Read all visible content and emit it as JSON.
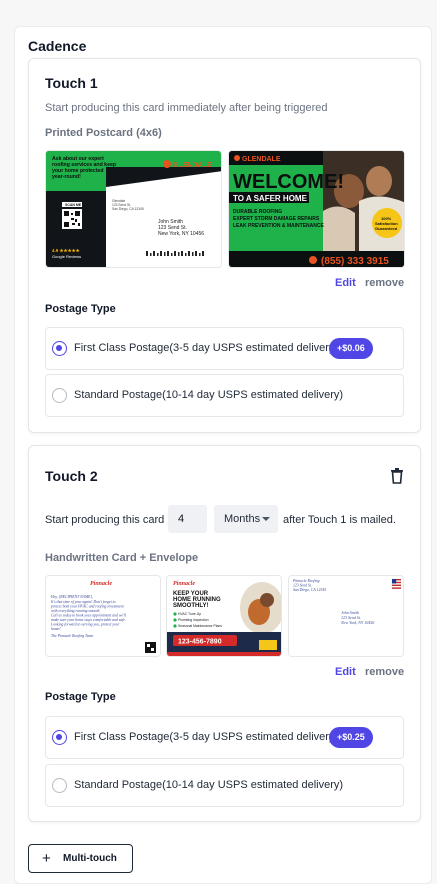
{
  "cadence": {
    "title": "Cadence"
  },
  "touch1": {
    "title": "Touch 1",
    "subtitle": "Start producing this card immediately after being triggered",
    "card_type": "Printed Postcard (4x6)",
    "front": {
      "headline": "Ask about our expert roofing services and keep your home protected year-round!",
      "scan_label": "SCAN ME",
      "rating": "4.9 ★★★★★",
      "reviews": "Google Reviews",
      "brand": "GLENDALE",
      "return_address": [
        "Glendale",
        "123 Send St.",
        "San Diego, CA 12345"
      ],
      "recipient": [
        "John Smith",
        "123 Send St.",
        "New York, NY 10456"
      ]
    },
    "back": {
      "brand": "GLENDALE",
      "welcome": "WELCOME!",
      "tagline": "TO A SAFER HOME",
      "bullets": [
        "DURABLE ROOFING",
        "EXPERT STORM DAMAGE REPAIRS",
        "LEAK PREVENTION & MAINTENANCE"
      ],
      "guarantee": "100% Satisfaction Guaranteed",
      "phone": "(855) 333 3915"
    },
    "edit_label": "Edit",
    "remove_label": "remove",
    "postage_title": "Postage Type",
    "options": [
      {
        "name": "First Class Postage",
        "desc": "(3-5 day USPS estimated delivery)",
        "price": "+$0.06",
        "selected": true
      },
      {
        "name": "Standard Postage",
        "desc": "(10-14 day USPS estimated delivery)",
        "selected": false
      }
    ]
  },
  "touch2": {
    "title": "Touch 2",
    "delete_icon": "trash-icon",
    "start_text": "Start producing this card",
    "delay_value": "4",
    "delay_unit": "Months",
    "after_text": "after Touch 1 is mailed.",
    "card_type": "Handwritten Card + Envelope",
    "letter": {
      "brand": "Pinnacle",
      "salutation": "Hey, [RECIPIENT NAME],",
      "lines": [
        "It's that time of year again! Don't forget to",
        "protect both your HVAC and roofing investment",
        "with everything running smooth.",
        "Call us today to book your appointment and we'll",
        "make sure your home stays comfortable and safe.",
        "Looking forward to serving you, protect your",
        "home!"
      ],
      "signoff": "The Pinnacle Roofing Team"
    },
    "promo": {
      "brand": "Pinnacle",
      "headline": "KEEP YOUR HOME RUNNING SMOOTHLY!",
      "features": [
        "HVAC Tune-Up",
        "Plumbing Inspection",
        "Seasonal Maintenance Plans"
      ],
      "phone": "123-456-7890"
    },
    "envelope": {
      "return_address": [
        "Pinnacle Roofing",
        "123 Send St.",
        "San Diego, CA 12345"
      ],
      "recipient": [
        "John Smith",
        "123 Send St.",
        "New York, NY 10456"
      ]
    },
    "edit_label": "Edit",
    "remove_label": "remove",
    "postage_title": "Postage Type",
    "options": [
      {
        "name": "First Class Postage",
        "desc": "(3-5 day USPS estimated delivery)",
        "price": "+$0.25",
        "selected": true
      },
      {
        "name": "Standard Postage",
        "desc": "(10-14 day USPS estimated delivery)",
        "selected": false
      }
    ]
  },
  "multi_touch": {
    "label": "Multi-touch",
    "icon": "plus-icon"
  },
  "colors": {
    "accent": "#4f46e5",
    "glendale_green": "#1fb24a",
    "glendale_orange": "#e8531f"
  }
}
